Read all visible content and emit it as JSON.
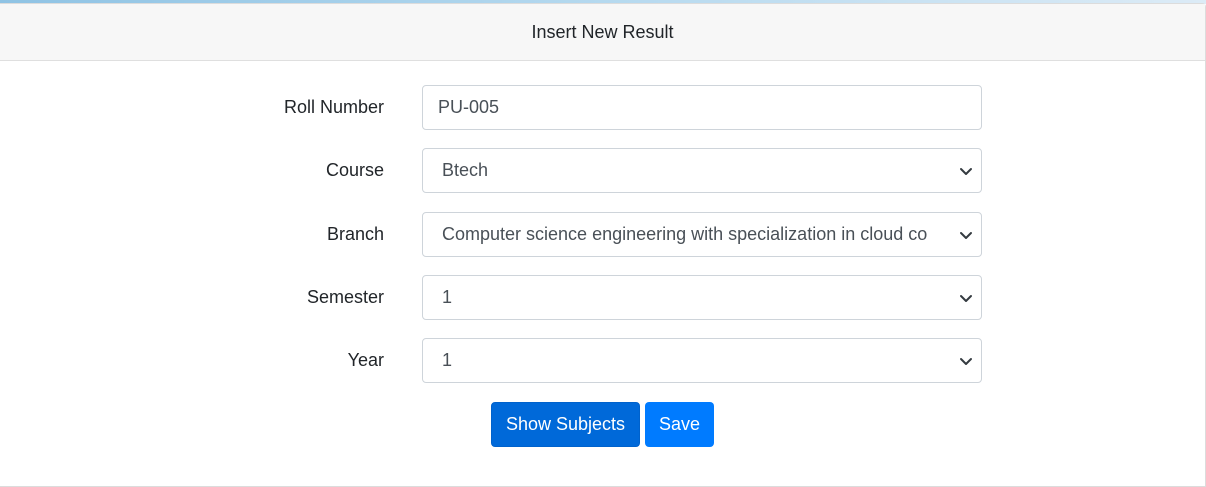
{
  "header": {
    "title": "Insert New Result"
  },
  "form": {
    "roll_number": {
      "label": "Roll Number",
      "value": "PU-005"
    },
    "course": {
      "label": "Course",
      "selected": "Btech"
    },
    "branch": {
      "label": "Branch",
      "selected": "Computer science engineering with specialization in cloud co"
    },
    "semester": {
      "label": "Semester",
      "selected": "1"
    },
    "year": {
      "label": "Year",
      "selected": "1"
    }
  },
  "actions": {
    "show_subjects_label": "Show Subjects",
    "save_label": "Save"
  },
  "colors": {
    "primary": "#007bff",
    "primary_active": "#0069d9",
    "header_bg": "#f7f7f7",
    "border": "#ced4da"
  },
  "icons": {
    "select_arrow": "chevron-down-icon"
  }
}
